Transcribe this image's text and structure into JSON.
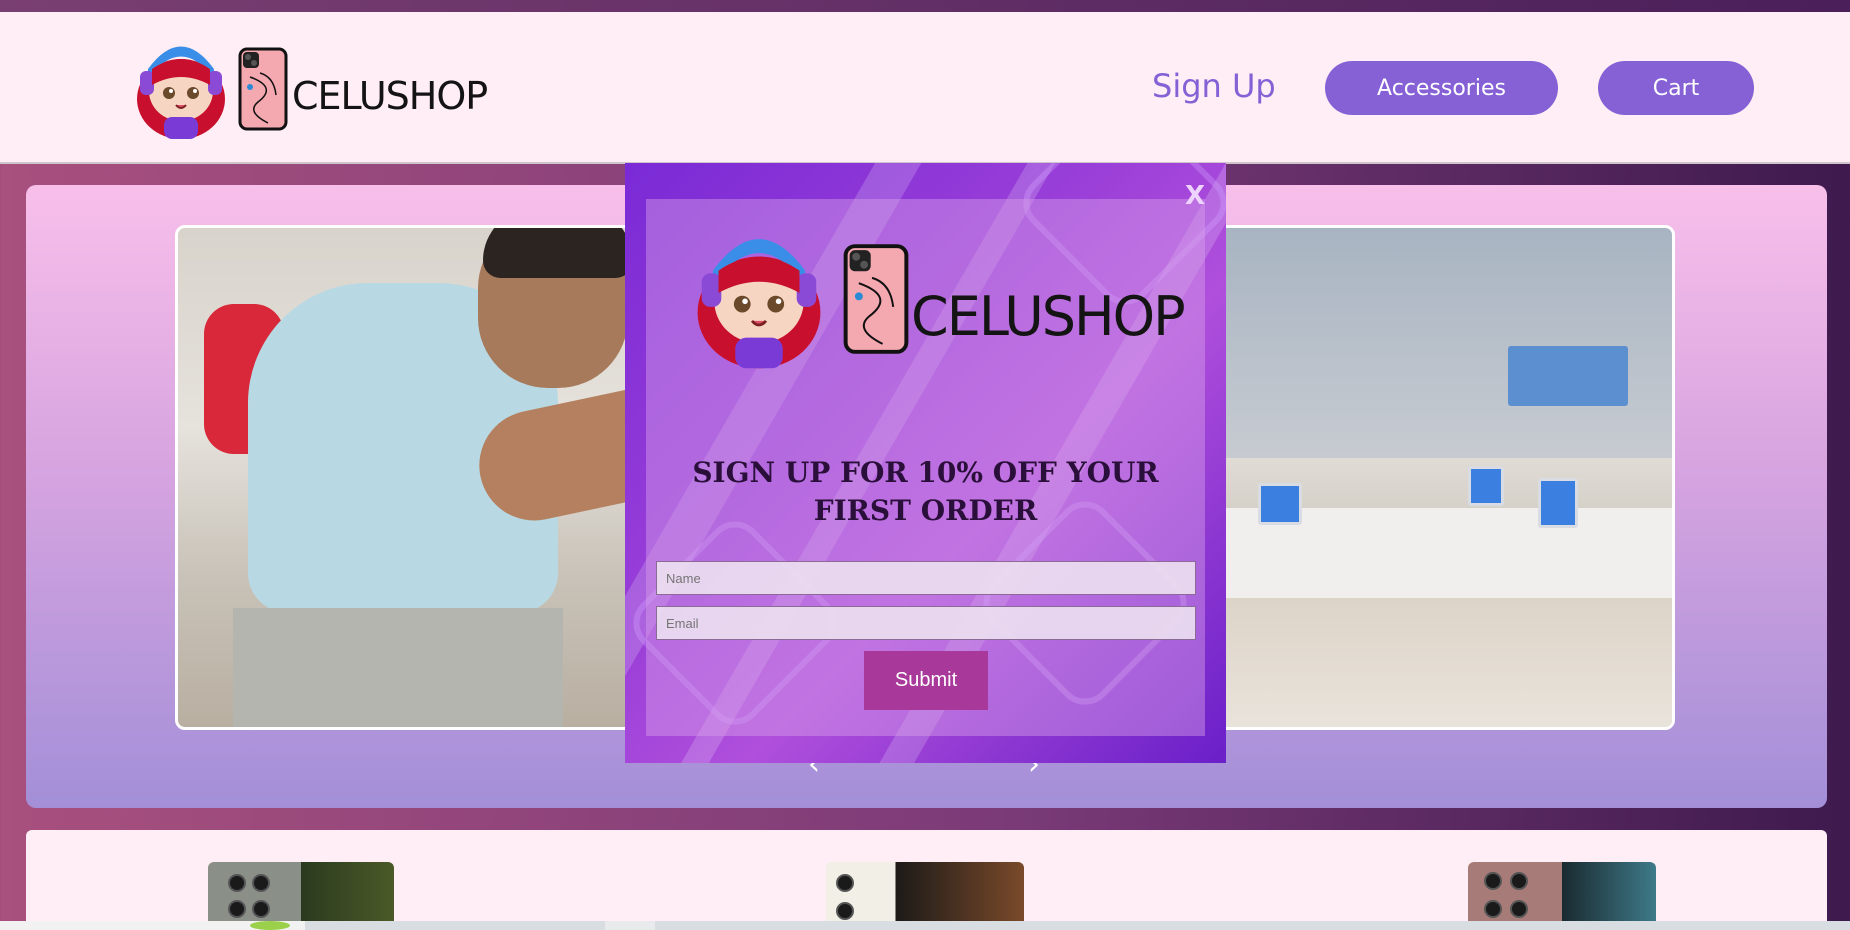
{
  "header": {
    "brand_name": "CELUSHOP",
    "nav": {
      "sign_up": "Sign Up",
      "accessories": "Accessories",
      "cart": "Cart"
    }
  },
  "hero": {
    "prev_arrow": "‹",
    "next_arrow": "›"
  },
  "modal": {
    "close_label": "X",
    "brand_name": "CELUSHOP",
    "heading": "SIGN UP FOR 10% OFF YOUR FIRST ORDER",
    "name_placeholder": "Name",
    "email_placeholder": "Email",
    "submit_label": "Submit"
  },
  "colors": {
    "accent": "#8661d6",
    "header_bg": "#ffeef5",
    "submit_bg": "#a8399a",
    "modal_bg": "#9a3fd8"
  },
  "icons": {
    "mascot": "anime-girl-headphones-icon",
    "phone": "phone-earbuds-icon",
    "close": "close-icon",
    "prev": "chevron-left-icon",
    "next": "chevron-right-icon"
  }
}
